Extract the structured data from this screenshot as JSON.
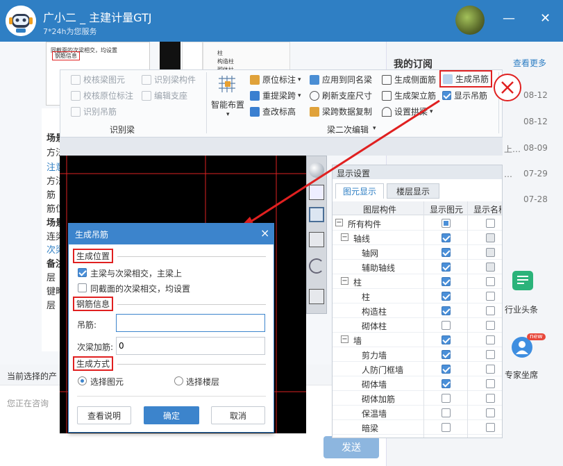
{
  "header": {
    "title": "广小二 _ 主建计量GTJ",
    "subtitle": "7*24h为您服务",
    "minimize": "—",
    "close": "✕"
  },
  "chat": {
    "lines": [
      "场景",
      "方法",
      "注意",
      "方法",
      "筋",
      "筋位",
      "场景",
      "连梁",
      "次梁",
      "备注",
      "层",
      "键略",
      "层"
    ],
    "product_prompt": "当前选择的产",
    "input_placeholder": "您正在咨询",
    "send": "发送",
    "thumb": {
      "row1": "同截面的次梁相交，均设置",
      "row2": "钢筋信息",
      "cells": [
        "柱",
        "构造柱",
        "砌体柱"
      ]
    }
  },
  "right": {
    "my_orders": "我的订阅",
    "see_more": "查看更多",
    "dates": [
      "08-12",
      "08-12",
      "08-09",
      "07-29",
      "07-28"
    ],
    "row_fragments": [
      "上…",
      "…"
    ],
    "news": "行业头条",
    "expert": "专家坐席",
    "new_badge": "new"
  },
  "ribbon": {
    "group1": {
      "items": [
        "校核梁图元",
        "识别梁构件",
        "校核原位标注",
        "编辑支座",
        "识别吊筋"
      ],
      "label": "识别梁"
    },
    "smart": "智能布置",
    "group2": {
      "items": [
        "原位标注",
        "应用到同名梁",
        "生成侧面筋",
        "生成吊筋",
        "重提梁跨",
        "刷新支座尺寸",
        "生成架立筋",
        "显示吊筋",
        "查改标高",
        "梁跨数据复制",
        "设置拱梁"
      ],
      "label": "梁二次编辑"
    }
  },
  "display": {
    "title": "显示设置",
    "tabs": [
      "图元显示",
      "楼层显示"
    ],
    "columns": [
      "图层构件",
      "显示图元",
      "显示名称"
    ],
    "rows": [
      {
        "label": "所有构件",
        "level": 0,
        "exp": "−",
        "a": "part",
        "b": "off"
      },
      {
        "label": "轴线",
        "level": 1,
        "exp": "−",
        "a": "on",
        "b": "grey"
      },
      {
        "label": "轴网",
        "level": 2,
        "a": "on",
        "b": "grey"
      },
      {
        "label": "辅助轴线",
        "level": 2,
        "a": "on",
        "b": "grey"
      },
      {
        "label": "柱",
        "level": 1,
        "exp": "−",
        "a": "on",
        "b": "off"
      },
      {
        "label": "柱",
        "level": 2,
        "a": "on",
        "b": "off"
      },
      {
        "label": "构造柱",
        "level": 2,
        "a": "on",
        "b": "off"
      },
      {
        "label": "砌体柱",
        "level": 2,
        "a": "off",
        "b": "off"
      },
      {
        "label": "墙",
        "level": 1,
        "exp": "−",
        "a": "on",
        "b": "off"
      },
      {
        "label": "剪力墙",
        "level": 2,
        "a": "on",
        "b": "off"
      },
      {
        "label": "人防门框墙",
        "level": 2,
        "a": "on",
        "b": "off"
      },
      {
        "label": "砌体墙",
        "level": 2,
        "a": "on",
        "b": "off"
      },
      {
        "label": "砌体加筋",
        "level": 2,
        "a": "off",
        "b": "off"
      },
      {
        "label": "保温墙",
        "level": 2,
        "a": "off",
        "b": "off"
      },
      {
        "label": "暗梁",
        "level": 2,
        "a": "off",
        "b": "off"
      }
    ]
  },
  "dialog": {
    "title": "生成吊筋",
    "close": "×",
    "sec_position": "生成位置",
    "opt1": "主梁与次梁相交，主梁上",
    "opt2": "同截面的次梁相交，均设置",
    "sec_rebar": "钢筋信息",
    "hanger_label": "吊筋:",
    "hanger_value": "",
    "secondary_label": "次梁加筋:",
    "secondary_value": "0",
    "sec_mode": "生成方式",
    "radio1": "选择图元",
    "radio2": "选择楼层",
    "btn_help": "查看说明",
    "btn_ok": "确定",
    "btn_cancel": "取消"
  },
  "colors": {
    "header": "#2f7fc4",
    "accent": "#3c84cc",
    "highlight": "#e02020"
  }
}
